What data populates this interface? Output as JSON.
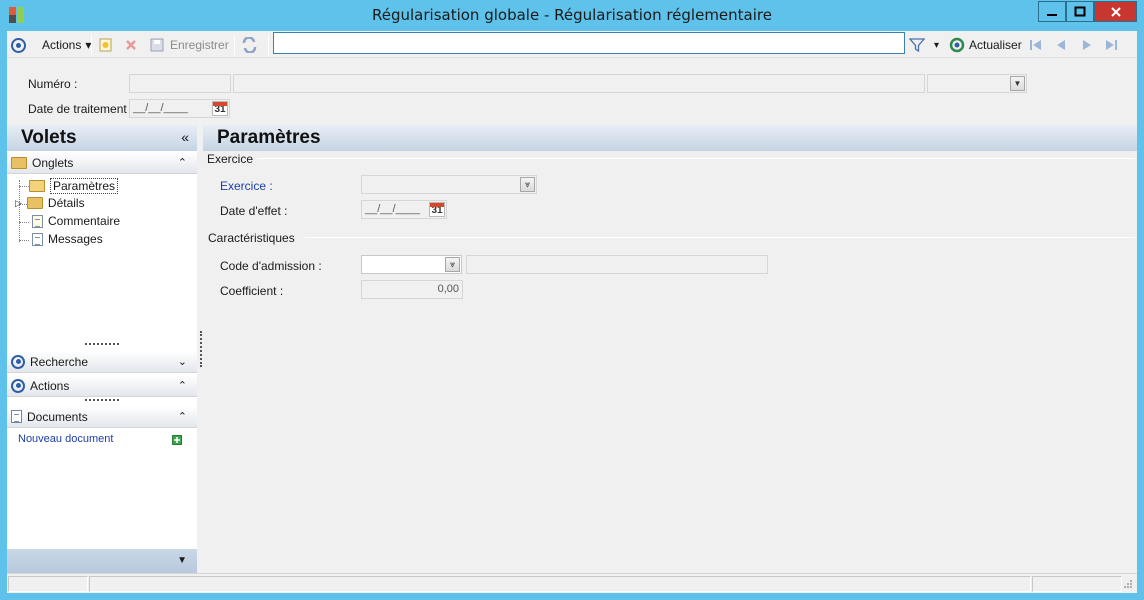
{
  "window": {
    "title": "Régularisation globale - Régularisation réglementaire",
    "controls": {
      "minimize": "🗕",
      "maximize": "🗖",
      "close": "✕"
    }
  },
  "toolbar": {
    "actions_label": "Actions",
    "save_label": "Enregistrer",
    "search_value": "",
    "refresh_label": "Actualiser",
    "dropdown_caret": "▾"
  },
  "header": {
    "numero_label": "Numéro :",
    "date_label": "Date de traitement :",
    "date_value": "__/__/____",
    "calendar_day": "31"
  },
  "sidebar": {
    "title": "Volets",
    "collapse_glyph": "«",
    "onglets": {
      "title": "Onglets",
      "items": [
        {
          "label": "Paramètres",
          "icon": "folder-open-icon"
        },
        {
          "label": "Détails",
          "icon": "folder-icon"
        },
        {
          "label": "Commentaire",
          "icon": "document-icon"
        },
        {
          "label": "Messages",
          "icon": "document-icon"
        }
      ]
    },
    "recherche": {
      "title": "Recherche",
      "chevron": "⌄"
    },
    "actions": {
      "title": "Actions",
      "chevron": "⌃"
    },
    "documents": {
      "title": "Documents",
      "new_document": "Nouveau document"
    }
  },
  "content": {
    "title": "Paramètres",
    "exercice_group": {
      "title": "Exercice",
      "exercice_label": "Exercice :",
      "date_effet_label": "Date d'effet :",
      "date_effet_value": "__/__/____"
    },
    "caracteristiques_group": {
      "title": "Caractéristiques",
      "code_admission_label": "Code d'admission :",
      "coefficient_label": "Coefficient :",
      "coefficient_value": "0,00"
    }
  },
  "colors": {
    "titlebar": "#5ec2ea",
    "close_button": "#c7372f",
    "link": "#1d3ea8"
  }
}
